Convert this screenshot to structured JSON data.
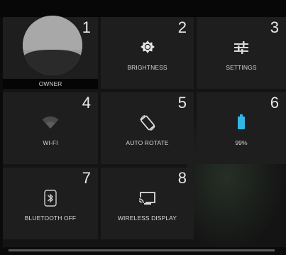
{
  "quick_settings": {
    "tiles": [
      {
        "number": "1",
        "label": "OWNER",
        "icon": "user-avatar-icon"
      },
      {
        "number": "2",
        "label": "BRIGHTNESS",
        "icon": "brightness-icon"
      },
      {
        "number": "3",
        "label": "SETTINGS",
        "icon": "settings-sliders-icon"
      },
      {
        "number": "4",
        "label": "WI-FI",
        "icon": "wifi-icon"
      },
      {
        "number": "5",
        "label": "AUTO ROTATE",
        "icon": "auto-rotate-icon"
      },
      {
        "number": "6",
        "label": "99%",
        "icon": "battery-icon"
      },
      {
        "number": "7",
        "label": "BLUETOOTH OFF",
        "icon": "bluetooth-icon"
      },
      {
        "number": "8",
        "label": "WIRELESS DISPLAY",
        "icon": "wireless-display-icon"
      }
    ]
  },
  "colors": {
    "tile_bg": "#1e1e1e",
    "accent_battery": "#33b5e5",
    "text": "#d6d6d6"
  }
}
